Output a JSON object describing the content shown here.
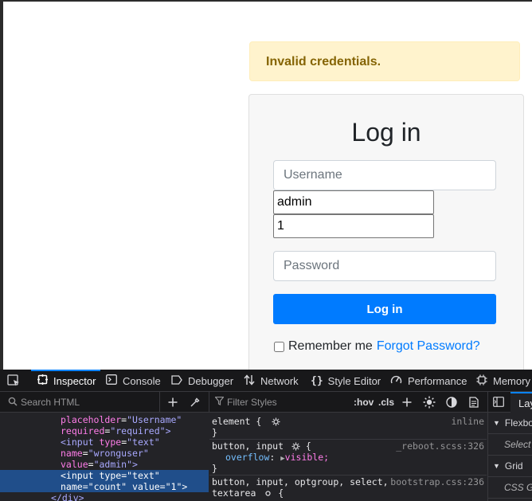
{
  "page": {
    "alert_text": "Invalid credentials.",
    "card_title": "Log in",
    "username_placeholder": "Username",
    "wronguser_value": "admin",
    "count_value": "1",
    "password_placeholder": "Password",
    "login_button": "Log in",
    "remember_label": "Remember me",
    "forgot_link": "Forgot Password?"
  },
  "devtools": {
    "tabs": [
      {
        "label": "Inspector",
        "icon": "inspector-icon"
      },
      {
        "label": "Console",
        "icon": "console-icon"
      },
      {
        "label": "Debugger",
        "icon": "debugger-icon"
      },
      {
        "label": "Network",
        "icon": "network-icon"
      },
      {
        "label": "Style Editor",
        "icon": "style-editor-icon"
      },
      {
        "label": "Performance",
        "icon": "performance-icon"
      },
      {
        "label": "Memory",
        "icon": "memory-icon"
      }
    ],
    "search_placeholder": "Search HTML",
    "filter_placeholder": "Filter Styles",
    "hov": ":hov",
    "cls": ".cls",
    "markup": {
      "l1_attr": "placeholder",
      "l1_val": "\"Username\"",
      "l2_attr": "required",
      "l2_val": "\"required\"",
      "l3_tag": "<input",
      "l3_attr": "type",
      "l3_val": "\"text\"",
      "l4_attr": "name",
      "l4_val": "\"wronguser\"",
      "l5_attr": "value",
      "l5_val": "\"admin\"",
      "l6_tag": "<input",
      "l6_attr": "type",
      "l6_val": "\"text\"",
      "l7_attr": "name",
      "l7_val": "\"count\"",
      "l7_attr2": "value",
      "l7_val2": "\"1\"",
      "l8_tag": "</div>"
    },
    "rules": {
      "r1_selector": "element {",
      "r1_source": "inline",
      "r1_close": "}",
      "r2_selector": "button, input",
      "r2_source": "_reboot.scss:326",
      "r2_prop": "overflow",
      "r2_val": "visible;",
      "r2_close": "}",
      "r3_selector": "button, input, optgroup, select,",
      "r3_source": "bootstrap.css:236",
      "r3_selector2": "textarea"
    },
    "layout": {
      "tab": "Layout",
      "flexbox": "Flexbox",
      "flexbox_sub": "Select a Flex container or item to continue.",
      "grid": "Grid",
      "grid_sub": "CSS Grid is not in use on this page"
    }
  }
}
